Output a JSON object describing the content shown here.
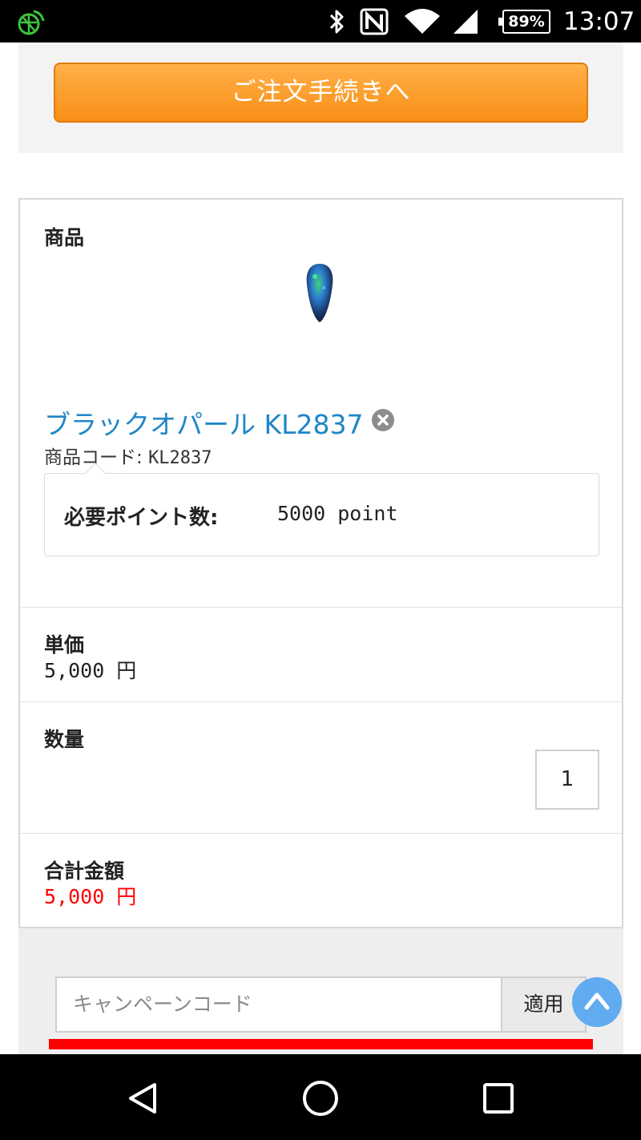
{
  "status_bar": {
    "battery": "89%",
    "time": "13:07",
    "icons": [
      "app-globe-icon",
      "bluetooth-icon",
      "nfc-icon",
      "wifi-icon",
      "signal-icon",
      "battery-icon"
    ]
  },
  "order_button": {
    "label": "ご注文手続きへ"
  },
  "product_section": {
    "heading": "商品",
    "product_name": "ブラックオパール KL2837",
    "code_label": "商品コード: ",
    "code_value": "KL2837",
    "points_label": "必要ポイント数:",
    "points_value": "5000 point"
  },
  "unit_price": {
    "label": "単価",
    "value": "5,000 円"
  },
  "quantity": {
    "label": "数量",
    "value": "1"
  },
  "total": {
    "label": "合計金額",
    "value": "5,000 円",
    "value_color": "#ff0000"
  },
  "campaign": {
    "placeholder": "キャンペーンコード",
    "apply_label": "適用"
  },
  "colors": {
    "accent_orange": "#f98f16",
    "link_blue": "#1f86c6",
    "scroll_button_blue": "#5aa8f2"
  },
  "nav_bar": {
    "icons": [
      "back-icon",
      "home-icon",
      "recents-icon"
    ]
  }
}
